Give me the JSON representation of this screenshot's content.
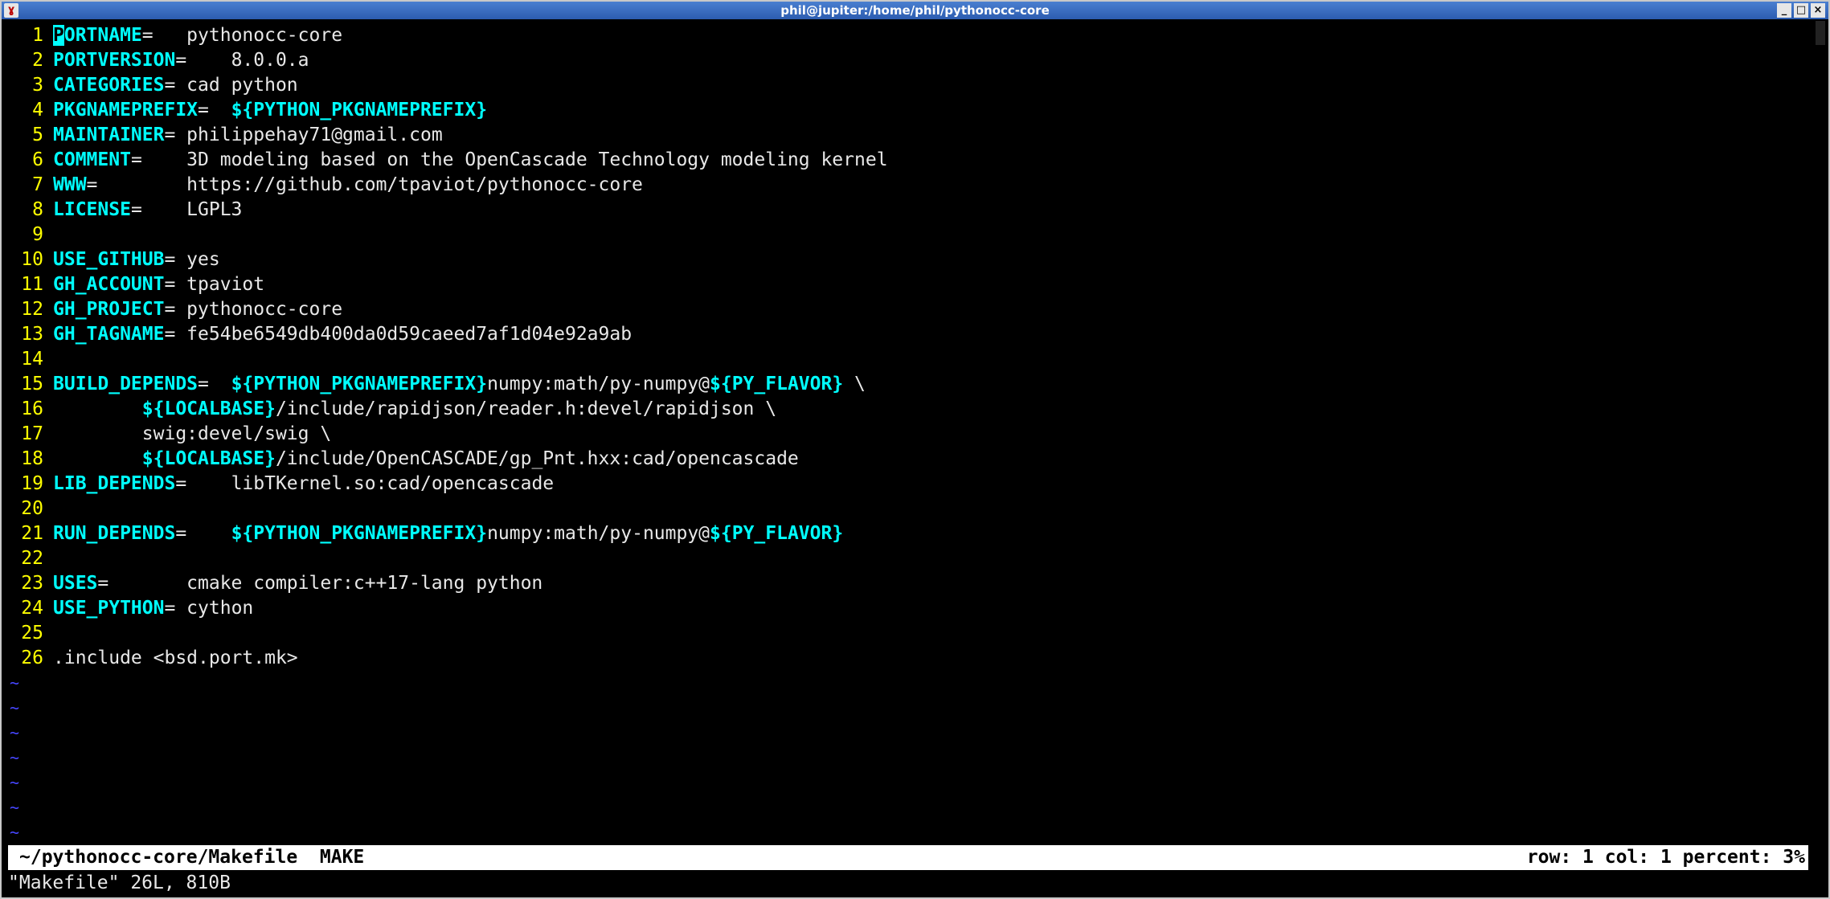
{
  "window": {
    "title": "phil@jupiter:/home/phil/pythonocc-core"
  },
  "editor": {
    "lines": [
      {
        "num": "1",
        "key": "PORTNAME",
        "rest": "=   pythonocc-core"
      },
      {
        "num": "2",
        "key": "PORTVERSION",
        "rest": "=    8.0.0.a"
      },
      {
        "num": "3",
        "key": "CATEGORIES",
        "rest": "= cad python"
      },
      {
        "num": "4",
        "key": "PKGNAMEPREFIX",
        "rest": "=  ",
        "var1": "${PYTHON_PKGNAMEPREFIX}"
      },
      {
        "num": "5",
        "key": "MAINTAINER",
        "rest": "= philippehay71@gmail.com"
      },
      {
        "num": "6",
        "key": "COMMENT",
        "rest": "=    3D modeling based on the OpenCascade Technology modeling kernel"
      },
      {
        "num": "7",
        "key": "WWW",
        "rest": "=        https://github.com/tpaviot/pythonocc-core"
      },
      {
        "num": "8",
        "key": "LICENSE",
        "rest": "=    LGPL3"
      },
      {
        "num": "9"
      },
      {
        "num": "10",
        "key": "USE_GITHUB",
        "rest": "= yes"
      },
      {
        "num": "11",
        "key": "GH_ACCOUNT",
        "rest": "= tpaviot"
      },
      {
        "num": "12",
        "key": "GH_PROJECT",
        "rest": "= pythonocc-core"
      },
      {
        "num": "13",
        "key": "GH_TAGNAME",
        "rest": "= fe54be6549db400da0d59caeed7af1d04e92a9ab"
      },
      {
        "num": "14"
      },
      {
        "num": "15",
        "key": "BUILD_DEPENDS",
        "rest": "=  ",
        "var1": "${PYTHON_PKGNAMEPREFIX}",
        "mid": "numpy:math/py-numpy@",
        "var2": "${PY_FLAVOR}",
        "tail": " \\"
      },
      {
        "num": "16",
        "rest": "        ",
        "var1": "${LOCALBASE}",
        "mid": "/include/rapidjson/reader.h:devel/rapidjson \\"
      },
      {
        "num": "17",
        "rest": "        swig:devel/swig \\"
      },
      {
        "num": "18",
        "rest": "        ",
        "var1": "${LOCALBASE}",
        "mid": "/include/OpenCASCADE/gp_Pnt.hxx:cad/opencascade"
      },
      {
        "num": "19",
        "key": "LIB_DEPENDS",
        "rest": "=    libTKernel.so:cad/opencascade"
      },
      {
        "num": "20"
      },
      {
        "num": "21",
        "key": "RUN_DEPENDS",
        "rest": "=    ",
        "var1": "${PYTHON_PKGNAMEPREFIX}",
        "mid": "numpy:math/py-numpy@",
        "var2": "${PY_FLAVOR}"
      },
      {
        "num": "22"
      },
      {
        "num": "23",
        "key": "USES",
        "rest": "=       cmake compiler:c++17-lang python"
      },
      {
        "num": "24",
        "key": "USE_PYTHON",
        "rest": "= cython"
      },
      {
        "num": "25"
      },
      {
        "num": "26",
        "rest": ".include <bsd.port.mk>"
      }
    ],
    "tilde": "~",
    "tilde_count": 7
  },
  "status": {
    "file": "~/pythonocc-core/Makefile  MAKE",
    "position": "row: 1 col: 1 percent: 3%"
  },
  "message": "\"Makefile\" 26L, 810B"
}
